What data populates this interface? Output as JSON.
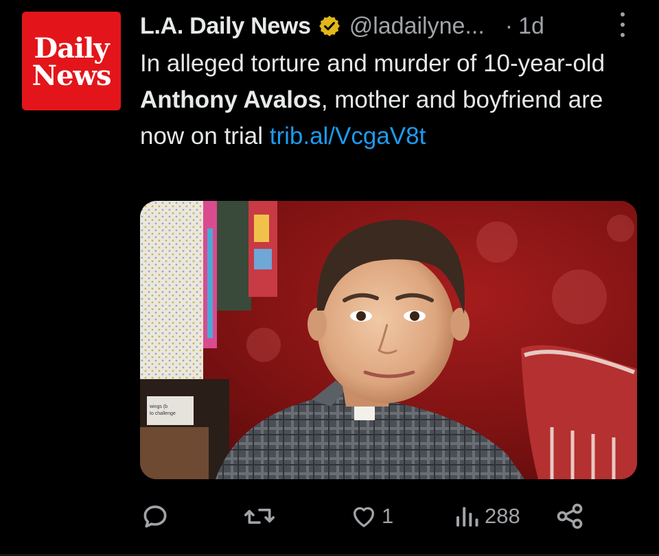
{
  "tweet": {
    "avatar": {
      "line1": "Daily",
      "line2": "News",
      "bg_color": "#e3151a"
    },
    "author_name": "L.A. Daily News",
    "verified_icon": "verified-badge-icon",
    "verified_color": "#e2b719",
    "handle": "@ladailyne...",
    "separator": "·",
    "time": "1d",
    "text": {
      "part1": "In alleged torture and murder of 10-year-old ",
      "bold": "Anthony Avalos",
      "part2": ", mother and boyfriend are now on trial ",
      "link": "trib.al/VcgaV8t"
    },
    "link_color": "#1d9bf0",
    "media": {
      "photo_icon": "child-portrait-photo",
      "sign_text_line1": "wings (b",
      "sign_text_line2": "to challenge"
    },
    "actions": {
      "reply": {
        "icon": "reply-icon",
        "count": ""
      },
      "retweet": {
        "icon": "retweet-icon",
        "count": ""
      },
      "like": {
        "icon": "heart-icon",
        "count": "1"
      },
      "views": {
        "icon": "views-chart-icon",
        "count": "288"
      },
      "share": {
        "icon": "share-icon"
      }
    }
  }
}
